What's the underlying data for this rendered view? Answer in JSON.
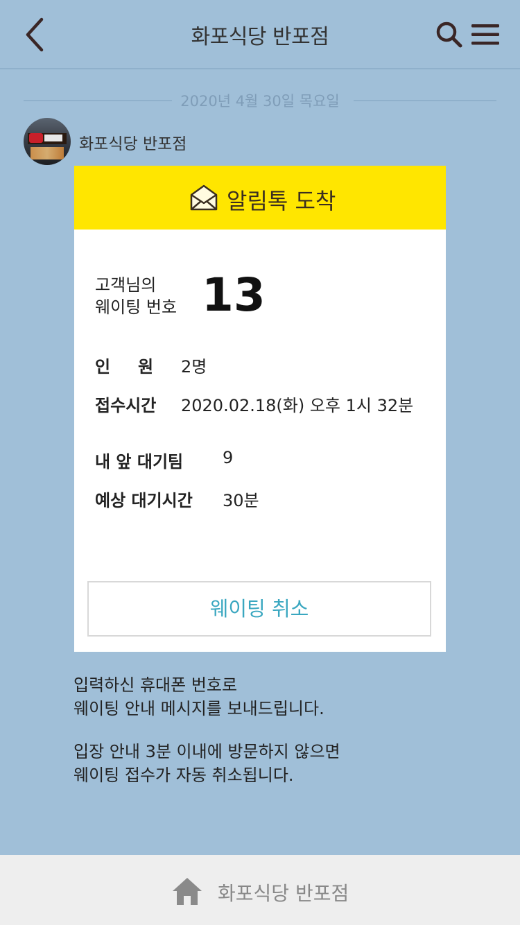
{
  "header": {
    "title": "화포식당 반포점",
    "back_icon": "chevron-left-icon",
    "search_icon": "search-icon",
    "menu_icon": "hamburger-menu-icon"
  },
  "chat": {
    "date": "2020년 4월 30일 목요일",
    "sender": "화포식당 반포점"
  },
  "card": {
    "header_title": "알림톡 도착",
    "header_icon": "envelope-icon",
    "waiting_label_line1": "고객님의",
    "waiting_label_line2": "웨이팅 번호",
    "waiting_number": "13",
    "party_label_1": "인",
    "party_label_2": "원",
    "party_value": "2명",
    "received_label": "접수시간",
    "received_value": "2020.02.18(화) 오후 1시 32분",
    "ahead_label": "내 앞 대기팀",
    "ahead_value": "9",
    "expected_label": "예상 대기시간",
    "expected_value": "30분",
    "cancel_button": "웨이팅 취소"
  },
  "notice": {
    "line1": "입력하신 휴대폰 번호로",
    "line2": "웨이팅 안내 메시지를 보내드립니다.",
    "line3": "입장 안내 3분 이내에 방문하지 않으면",
    "line4": "웨이팅 접수가 자동 취소됩니다."
  },
  "footer": {
    "label": "화포식당 반포점",
    "icon": "home-icon"
  },
  "colors": {
    "background": "#a0bfd8",
    "card_header": "#ffe600",
    "cancel_text": "#3aa7c0",
    "footer_bg": "#eeeeee"
  }
}
